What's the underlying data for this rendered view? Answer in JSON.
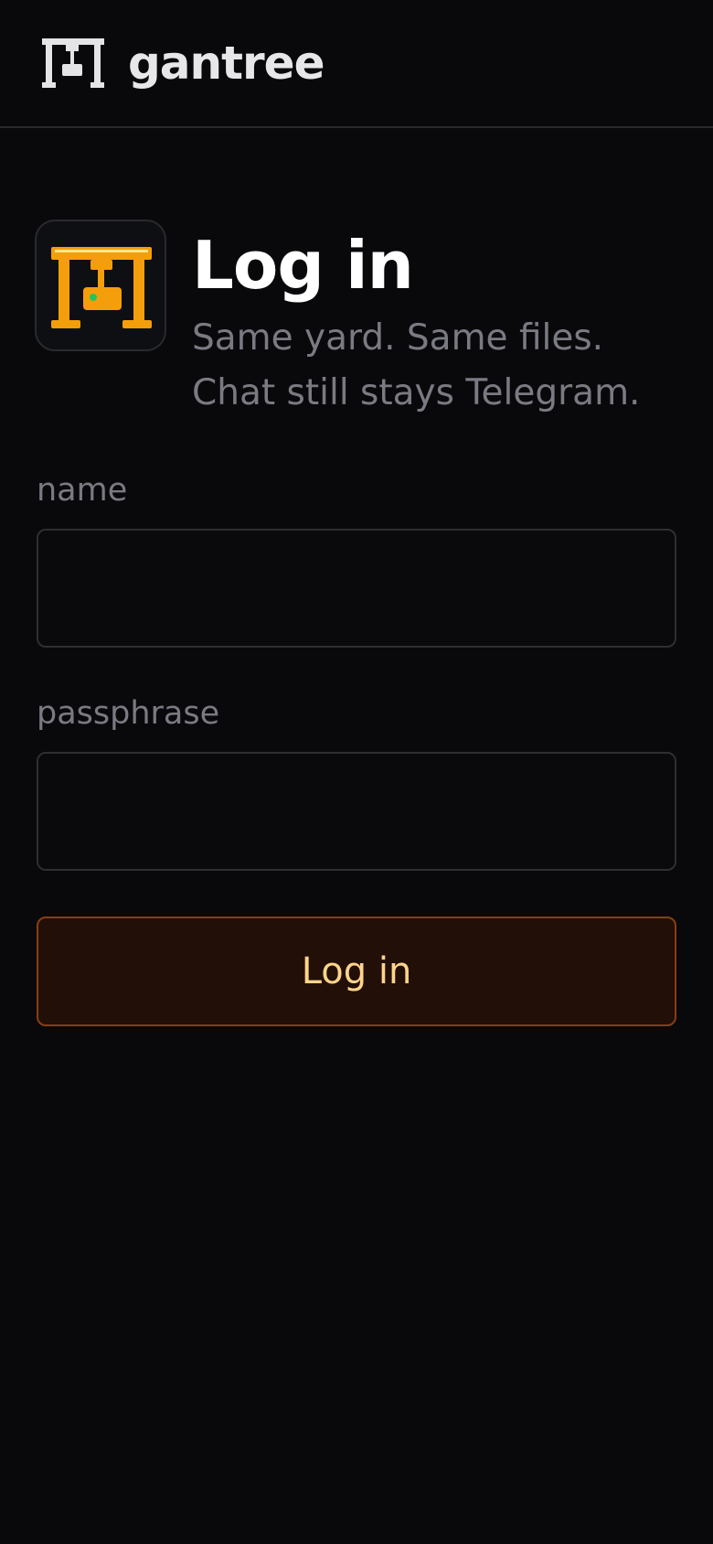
{
  "header": {
    "brand_icon": "gantry-crane-icon",
    "brand_name": "gantree"
  },
  "login": {
    "app_icon": "gantry-crane-icon",
    "title": "Log in",
    "subtitle": "Same yard. Same files. Chat still stays Telegram."
  },
  "form": {
    "name_label": "name",
    "name_value": "",
    "name_placeholder": "",
    "passphrase_label": "passphrase",
    "passphrase_value": "",
    "passphrase_placeholder": "",
    "submit_label": "Log in"
  },
  "colors": {
    "background": "#09090b",
    "accent": "#f59e0b",
    "accent_light": "#fde68a",
    "indicator": "#22c55e",
    "button_bg": "#220f08",
    "button_border": "#8a3e10",
    "button_text": "#fcd48a",
    "muted_text": "#7a7a82"
  }
}
